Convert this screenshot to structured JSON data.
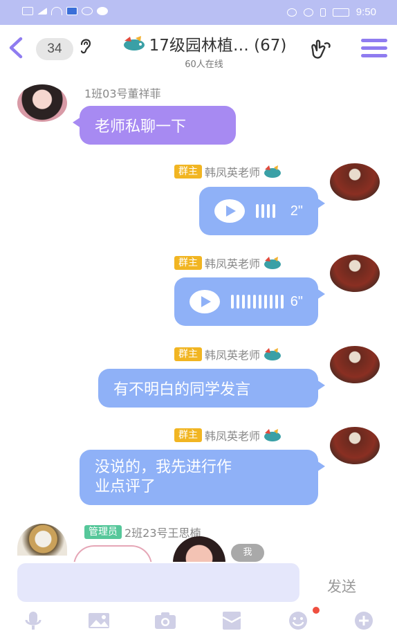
{
  "status": {
    "time": "9:50"
  },
  "header": {
    "count": "34",
    "title": "17级园林植… (67)",
    "online": "60人在线"
  },
  "messages": [
    {
      "side": "left",
      "sender": "1班03号董祥菲",
      "text": "老师私聊一下",
      "type": "text"
    },
    {
      "side": "right",
      "role": "群主",
      "sender": "韩凤英老师",
      "type": "voice",
      "duration": "2\""
    },
    {
      "side": "right",
      "role": "群主",
      "sender": "韩凤英老师",
      "type": "voice",
      "duration": "6\""
    },
    {
      "side": "right",
      "role": "群主",
      "sender": "韩凤英老师",
      "type": "text",
      "text": "有不明白的同学发言"
    },
    {
      "side": "right",
      "role": "群主",
      "sender": "韩凤英老师",
      "type": "text",
      "text_line1": "没说的，我先进行作",
      "text_line2": "业点评了"
    },
    {
      "side": "left",
      "role": "管理员",
      "sender": "2班23号王思楠",
      "type": "sticker",
      "me_label": "我"
    }
  ],
  "input": {
    "send_label": "发送",
    "placeholder": ""
  },
  "toolbar": {
    "icons": [
      "microphone-icon",
      "image-icon",
      "camera-icon",
      "red-envelope-icon",
      "emoji-icon",
      "plus-icon"
    ],
    "notification_dot": true
  },
  "colors": {
    "accent": "#8f7cf0",
    "left_bubble": "#a78af2",
    "right_bubble": "#8fb1f7",
    "owner_badge": "#f1b522",
    "admin_badge": "#56c79a",
    "status_bar": "#b9bff3"
  }
}
